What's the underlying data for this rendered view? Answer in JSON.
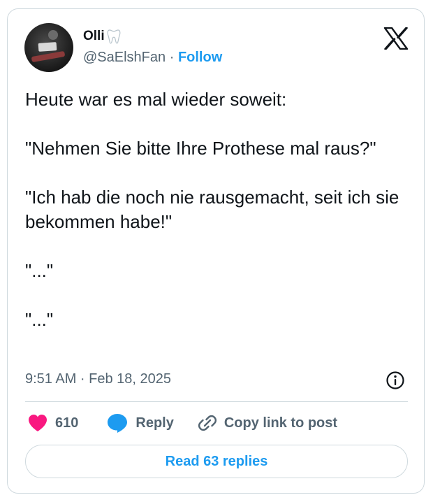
{
  "author": {
    "name": "Olli",
    "handle": "@SaElshFan",
    "separator": "·",
    "follow_label": "Follow",
    "name_icon": "tooth-icon"
  },
  "tweet": {
    "text": "Heute war es mal wieder soweit:\n\n\"Nehmen Sie bitte Ihre Prothese mal raus?\"\n\n\"Ich hab die noch nie rausgemacht, seit ich sie bekommen habe!\"\n\n\"...\"\n\n\"...\"",
    "timestamp": "9:51 AM · Feb 18, 2025"
  },
  "actions": {
    "like_count": "610",
    "reply_label": "Reply",
    "copy_link_label": "Copy link to post"
  },
  "footer": {
    "read_replies_label": "Read 63 replies"
  },
  "icons": {
    "brand": "x-logo-icon",
    "info": "info-icon",
    "like": "heart-icon",
    "reply": "speech-bubble-icon",
    "copy_link": "link-icon"
  },
  "colors": {
    "accent": "#1d9bf0",
    "like": "#f91880",
    "secondary_text": "#536471",
    "border": "#cfd9de"
  }
}
